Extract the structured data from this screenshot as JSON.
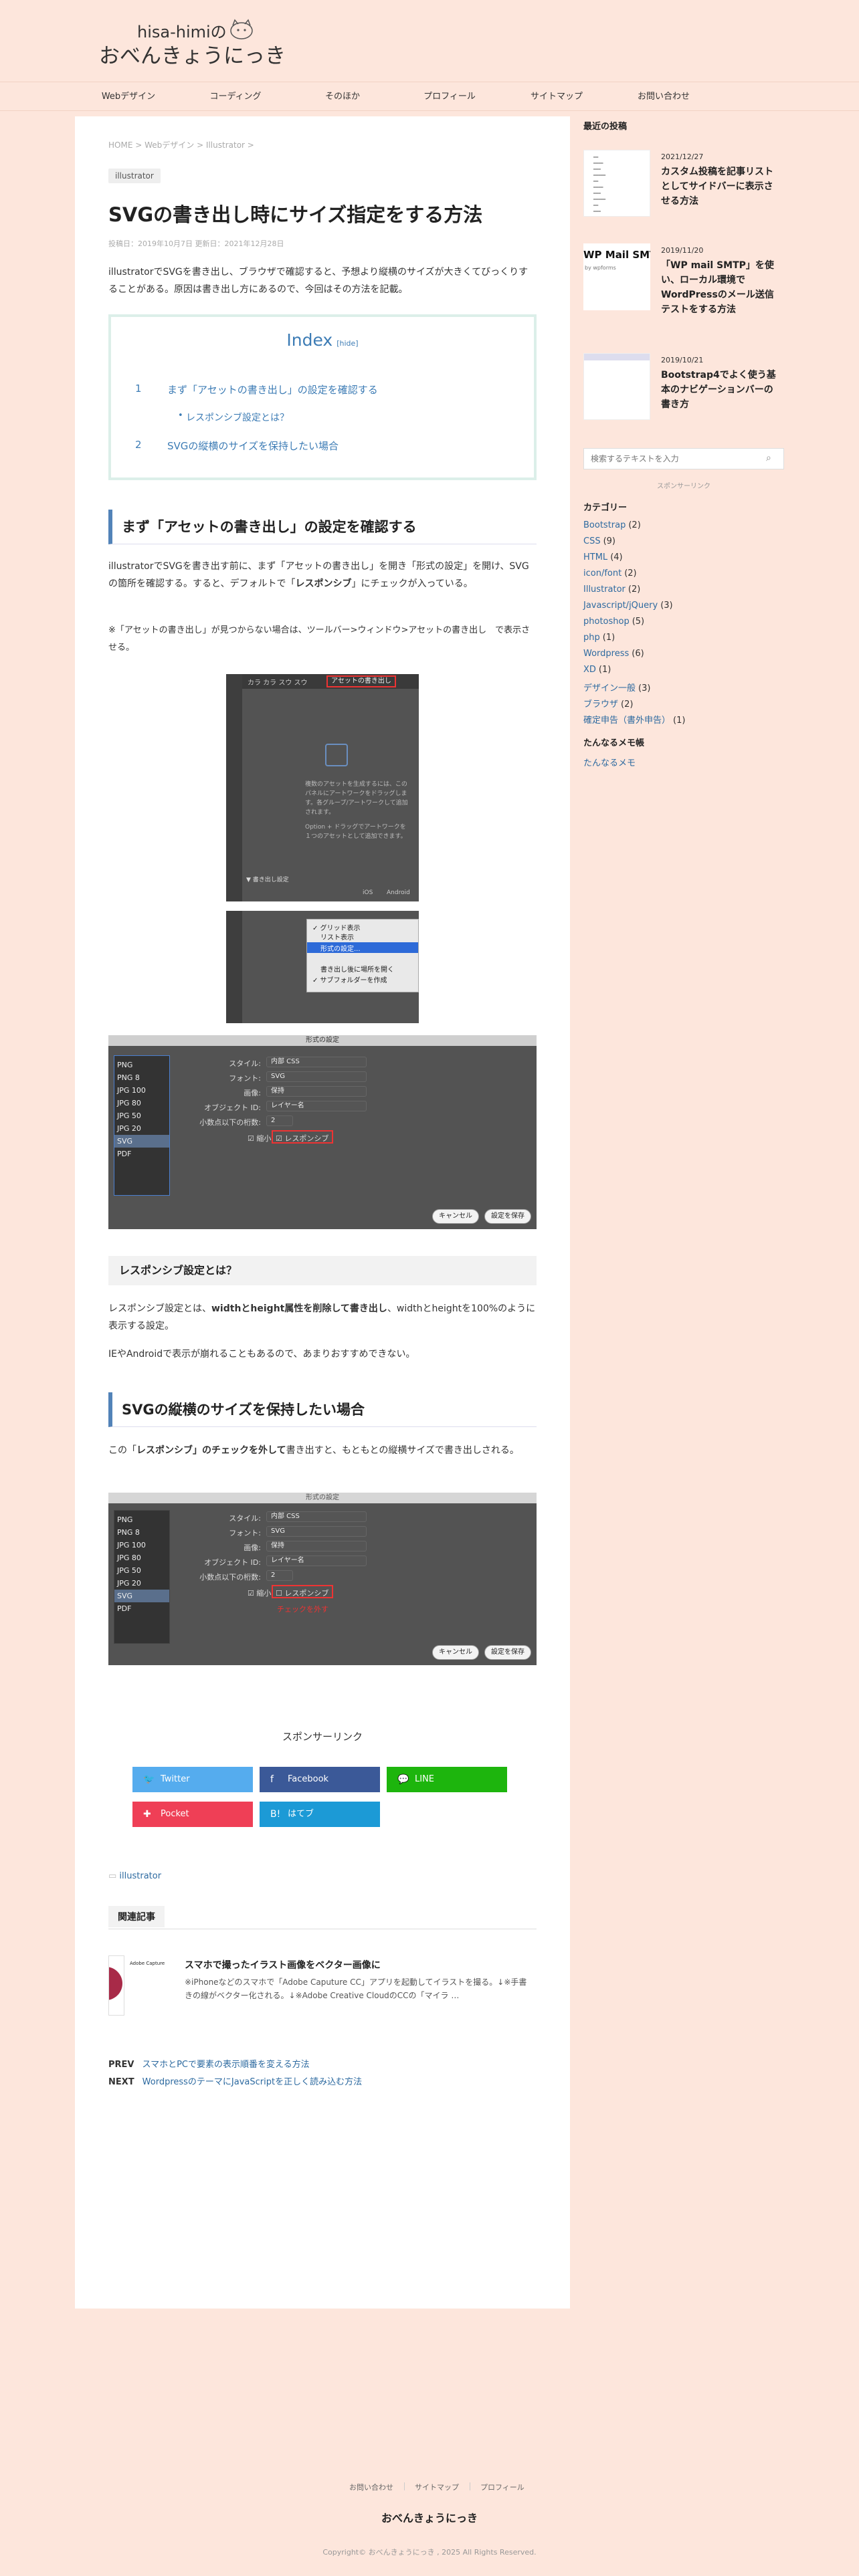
{
  "site": {
    "title_top": "hisa-himiの",
    "title_bottom": "おべんきょうにっき"
  },
  "nav": [
    "Webデザイン",
    "コーディング",
    "そのほか",
    "プロフィール",
    "サイトマップ",
    "お問い合わせ"
  ],
  "breadcrumb": "HOME > Webデザイン > Illustrator >",
  "article": {
    "category": "illustrator",
    "title": "SVGの書き出し時にサイズ指定をする方法",
    "dates": "投稿日：2019年10月7日 更新日：2021年12月28日",
    "intro": "illustratorでSVGを書き出し、ブラウザで確認すると、予想より縦横のサイズが大きくてびっくりすることがある。原因は書き出し方にあるので、今回はその方法を記載。",
    "toc": {
      "title": "Index",
      "hide": "[hide]",
      "items": [
        {
          "num": "1",
          "label": "まず「アセットの書き出し」の設定を確認する"
        },
        {
          "num": "•",
          "label": "レスポンシブ設定とは？"
        },
        {
          "num": "2",
          "label": "SVGの縦横のサイズを保持したい場合"
        }
      ]
    },
    "h2_1": "まず「アセットの書き出し」の設定を確認する",
    "p1_a": "illustratorでSVGを書き出す前に、まず「アセットの書き出し」を開き「形式の設定」を開け、SVGの箇所を確認する。すると、デフォルトで「",
    "p1_b": "レスポンシブ",
    "p1_c": "」にチェックが入っている。",
    "p2": "※「アセットの書き出し」が見つからない場合は、ツールバー>ウィンドウ>アセットの書き出し　で表示させる。",
    "panel1": {
      "tabs": "カラ  カラ  スウ  スウ",
      "tab_active": "アセットの書き出し",
      "desc1": "複数のアセットを生成するには、このパネルにアートワークをドラッグします。各グループ/アートワークして追加されます。",
      "desc2": "Option + ドラッグでアートワークを１つのアセットとして追加できます。",
      "setting": "▼ 書き出し設定",
      "ios": "iOS",
      "android": "Android"
    },
    "menu": {
      "items": [
        "✓ グリッド表示",
        "リスト表示",
        "形式の設定...",
        "書き出し後に場所を開く",
        "✓ サブフォルダーを作成"
      ]
    },
    "dialog1": {
      "title": "形式の設定",
      "formats": [
        "PNG",
        "PNG 8",
        "JPG 100",
        "JPG 80",
        "JPG 50",
        "JPG 20",
        "SVG",
        "PDF"
      ],
      "rows": [
        {
          "label": "スタイル:",
          "value": "内部 CSS"
        },
        {
          "label": "フォント:",
          "value": "SVG"
        },
        {
          "label": "画像:",
          "value": "保持"
        },
        {
          "label": "オブジェクト ID:",
          "value": "レイヤー名"
        },
        {
          "label": "小数点以下の桁数:",
          "value": "2"
        }
      ],
      "minify": "縮小",
      "responsive": "レスポンシブ",
      "cancel": "キャンセル",
      "save": "設定を保存"
    },
    "h3_1": "レスポンシブ設定とは？",
    "p3_a": "レスポンシブ設定とは、",
    "p3_b": "widthとheight属性を削除して書き出し",
    "p3_c": "、widthとheightを100%のように表示する設定。",
    "p4": "IEやAndroidで表示が崩れることもあるので、あまりおすすめできない。",
    "h2_2": "SVGの縦横のサイズを保持したい場合",
    "p5_a": "この「",
    "p5_b": "レスポンシブ」のチェックを外して",
    "p5_c": "書き出すと、もともとの縦横サイズで書き出しされる。",
    "dialog2": {
      "title": "形式の設定",
      "note": "チェックを外す"
    },
    "sponsor": "スポンサーリンク",
    "share": [
      {
        "label": "Twitter",
        "icon": "🐦",
        "color": "#55acee"
      },
      {
        "label": "Facebook",
        "icon": "f",
        "color": "#3b5998"
      },
      {
        "label": "LINE",
        "icon": "💬",
        "color": "#1db50d"
      },
      {
        "label": "Pocket",
        "icon": "✚",
        "color": "#ef3f56"
      },
      {
        "label": "はてブ",
        "icon": "B!",
        "color": "#1c9ad6"
      }
    ],
    "tag": "illustrator",
    "related_title": "関連記事",
    "related": {
      "title": "スマホで撮ったイラスト画像をベクター画像に",
      "excerpt": "※iPhoneなどのスマホで「Adobe Caputure CC」アプリを起動してイラストを撮る。↓※手書きの線がベクター化される。↓※Adobe Creative CloudのCCの「マイラ …",
      "thumb_title": "Adobe Capture"
    },
    "prev_label": "PREV",
    "prev": "スマホとPCで要素の表示順番を変える方法",
    "next_label": "NEXT",
    "next": "WordpressのテーマにJavaScriptを正しく読み込む方法"
  },
  "sidebar": {
    "recent_title": "最近の投稿",
    "posts": [
      {
        "date": "2021/12/27",
        "title": "カスタム投稿を記事リストとしてサイドバーに表示させる方法"
      },
      {
        "date": "2019/11/20",
        "title": "「WP mail SMTP」を使い、ローカル環境でWordPressのメール送信テストをする方法",
        "thumb": "WP Mail SMTP",
        "thumb_sub": "by wpforms"
      },
      {
        "date": "2019/10/21",
        "title": "Bootstrap4でよく使う基本のナビゲーションバーの書き方"
      }
    ],
    "search_placeholder": "検索するテキストを入力",
    "sponsor": "スポンサーリンク",
    "cat_title": "カテゴリー",
    "categories": [
      {
        "name": "Bootstrap",
        "count": "(2)"
      },
      {
        "name": "CSS",
        "count": "(9)"
      },
      {
        "name": "HTML",
        "count": "(4)"
      },
      {
        "name": "icon/font",
        "count": "(2)"
      },
      {
        "name": "Illustrator",
        "count": "(2)"
      },
      {
        "name": "Javascript/jQuery",
        "count": "(3)"
      },
      {
        "name": "photoshop",
        "count": "(5)"
      },
      {
        "name": "php",
        "count": "(1)"
      },
      {
        "name": "Wordpress",
        "count": "(6)"
      },
      {
        "name": "XD",
        "count": "(1)"
      },
      {
        "name": "デザイン一般",
        "count": "(3)"
      },
      {
        "name": "ブラウザ",
        "count": "(2)"
      },
      {
        "name": "確定申告（書外申告）",
        "count": "(1)"
      }
    ],
    "memo_title": "たんなるメモ帳",
    "memo_link": "たんなるメモ"
  },
  "footer": {
    "links": [
      "お問い合わせ",
      "サイトマップ",
      "プロフィール"
    ],
    "site": "おべんきょうにっき",
    "copy": "Copyright© おべんきょうにっき , 2025 All Rights Reserved."
  }
}
